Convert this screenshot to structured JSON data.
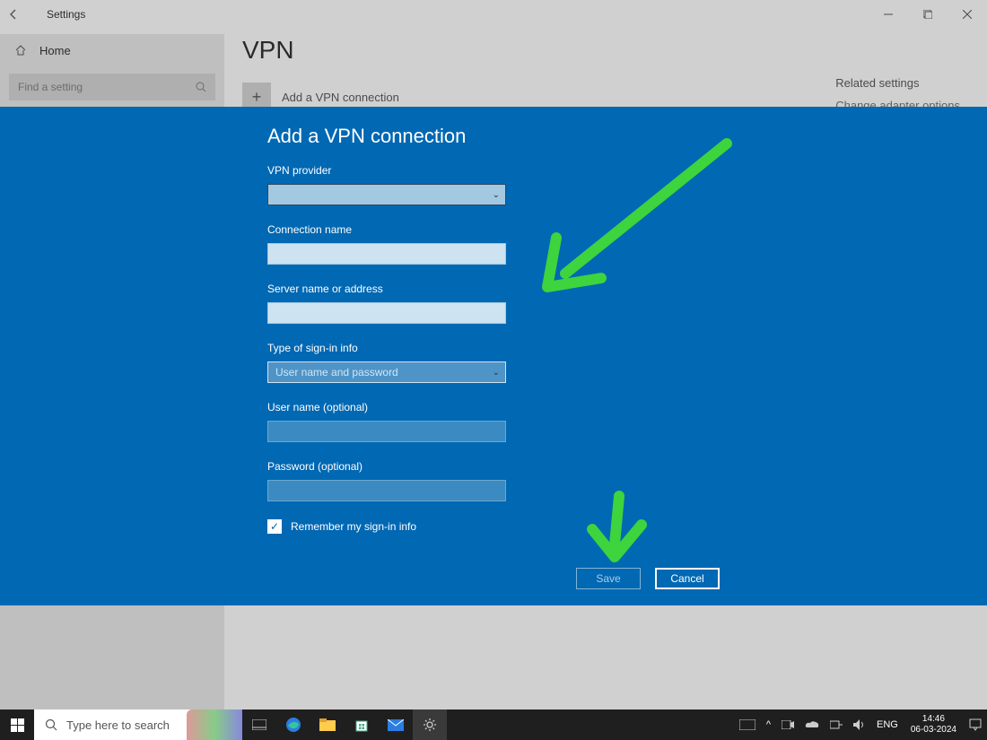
{
  "window": {
    "title": "Settings"
  },
  "sidebar": {
    "home": "Home",
    "search_placeholder": "Find a setting"
  },
  "page": {
    "heading": "VPN",
    "add_vpn": "Add a VPN connection",
    "related_heading": "Related settings",
    "related_link": "Change adapter options"
  },
  "modal": {
    "title": "Add a VPN connection",
    "fields": {
      "provider_label": "VPN provider",
      "provider_value": "",
      "conn_label": "Connection name",
      "server_label": "Server name or address",
      "signin_label": "Type of sign-in info",
      "signin_value": "User name and password",
      "user_label": "User name (optional)",
      "pass_label": "Password (optional)",
      "remember": "Remember my sign-in info"
    },
    "buttons": {
      "save": "Save",
      "cancel": "Cancel"
    }
  },
  "taskbar": {
    "search_placeholder": "Type here to search",
    "lang": "ENG",
    "time": "14:46",
    "date": "06-03-2024"
  }
}
